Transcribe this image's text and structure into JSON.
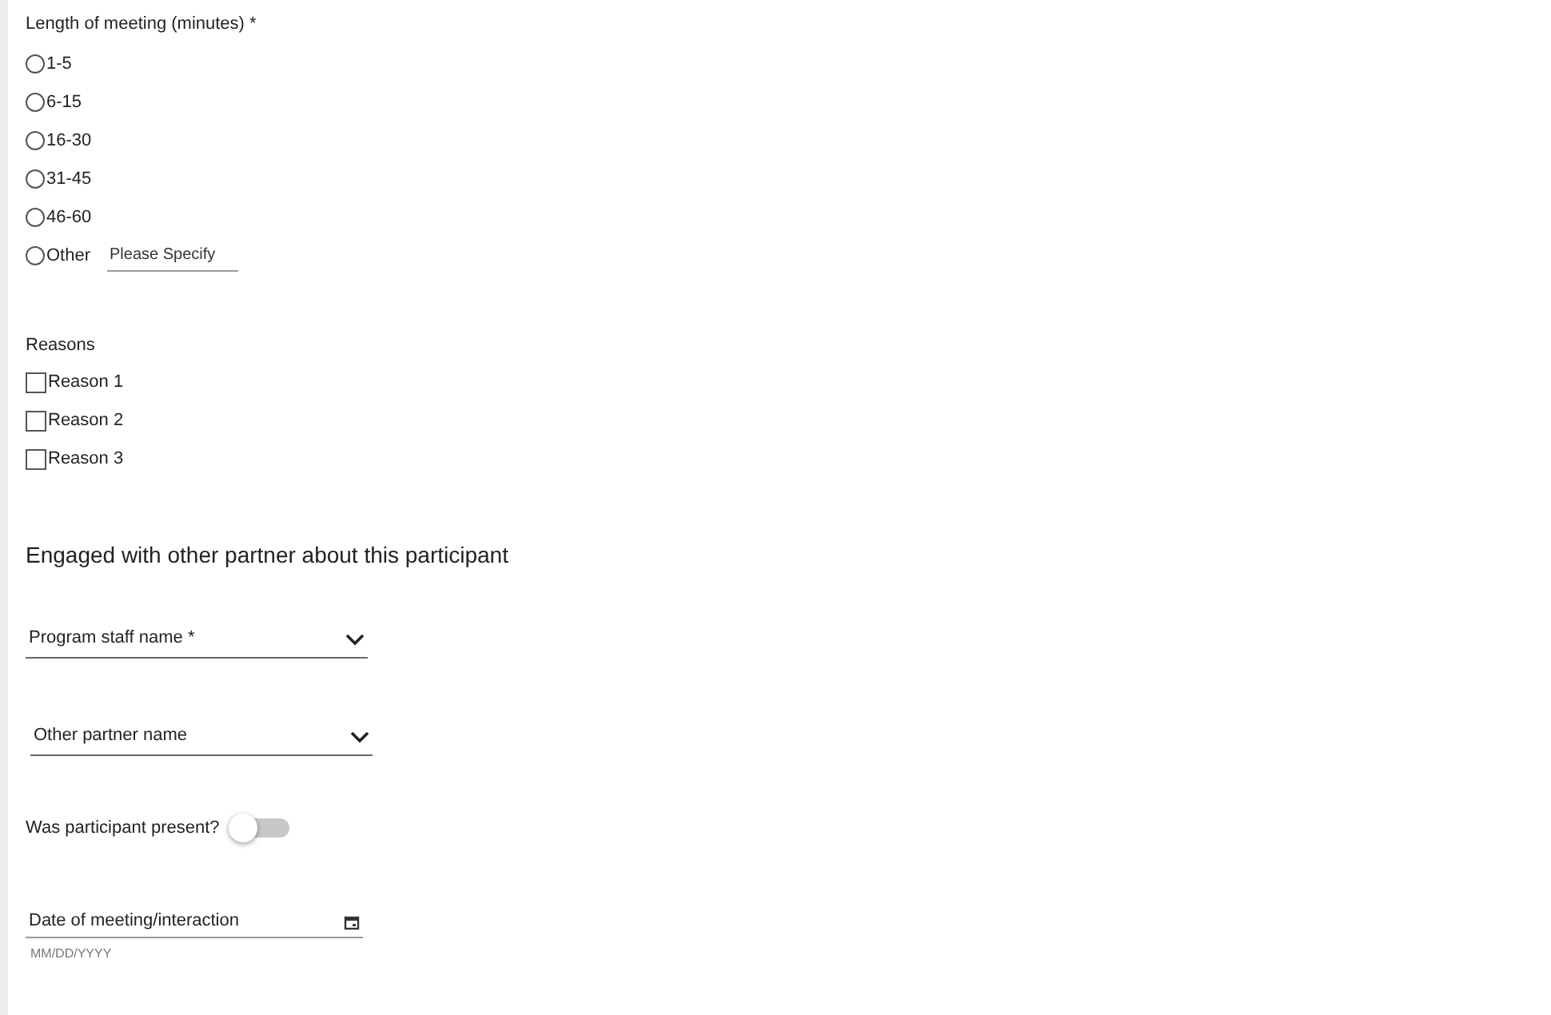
{
  "length_of_meeting": {
    "label": "Length of meeting (minutes) *",
    "options": [
      {
        "label": "1-5",
        "selected": false
      },
      {
        "label": "6-15",
        "selected": false
      },
      {
        "label": "16-30",
        "selected": false
      },
      {
        "label": "31-45",
        "selected": false
      },
      {
        "label": "46-60",
        "selected": false
      },
      {
        "label": "Other",
        "selected": false
      }
    ],
    "other_field": {
      "placeholder": "Please Specify"
    }
  },
  "reasons": {
    "label": "Reasons",
    "options": [
      {
        "label": "Reason 1",
        "checked": false
      },
      {
        "label": "Reason 2",
        "checked": false
      },
      {
        "label": "Reason 3",
        "checked": false
      }
    ]
  },
  "section_heading": "Engaged with other partner about this participant",
  "dropdowns": [
    {
      "label": "Program staff name *"
    },
    {
      "label": "Other partner name"
    }
  ],
  "participant_present": {
    "label": "Was participant present?",
    "on": false
  },
  "date_field": {
    "label": "Date of meeting/interaction",
    "hint": "MM/DD/YYYY"
  }
}
